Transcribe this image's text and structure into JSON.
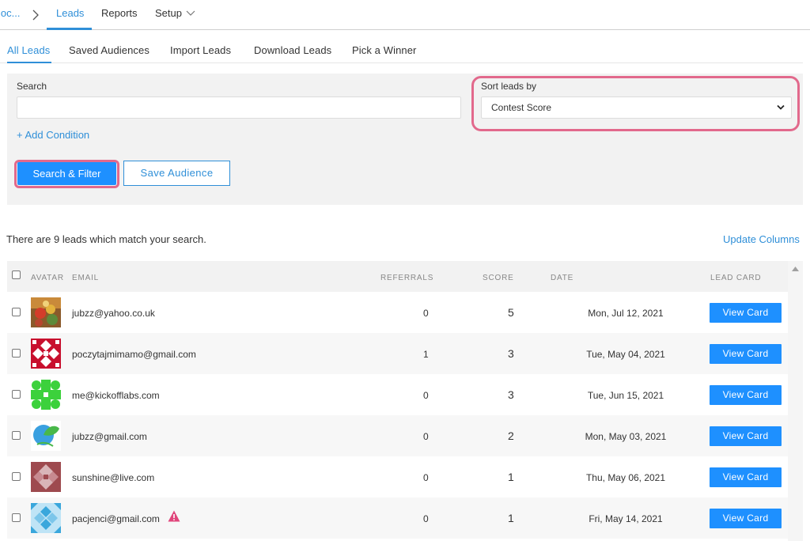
{
  "topnav": {
    "crumb": "loc...",
    "items": [
      "Leads",
      "Reports",
      "Setup"
    ]
  },
  "subtabs": [
    "All Leads",
    "Saved Audiences",
    "Import Leads",
    "Download Leads",
    "Pick a Winner"
  ],
  "filter": {
    "search_label": "Search",
    "search_value": "",
    "sort_label": "Sort leads by",
    "sort_value": "Contest Score",
    "add_condition": "+ Add Condition",
    "search_button": "Search & Filter",
    "save_button": "Save Audience"
  },
  "summary": {
    "match_text": "There are 9 leads which match your search.",
    "update_columns": "Update Columns"
  },
  "table": {
    "headers": [
      "AVATAR",
      "EMAIL",
      "REFERRALS",
      "SCORE",
      "DATE",
      "LEAD CARD"
    ],
    "rows": [
      {
        "email": "jubzz@yahoo.co.uk",
        "referrals": "0",
        "score": "5",
        "date": "Mon, Jul 12, 2021",
        "action": "View Card"
      },
      {
        "email": "poczytajmimamo@gmail.com",
        "referrals": "1",
        "score": "3",
        "date": "Tue, May 04, 2021",
        "action": "View Card"
      },
      {
        "email": "me@kickofflabs.com",
        "referrals": "0",
        "score": "3",
        "date": "Tue, Jun 15, 2021",
        "action": "View Card"
      },
      {
        "email": "jubzz@gmail.com",
        "referrals": "0",
        "score": "2",
        "date": "Mon, May 03, 2021",
        "action": "View Card"
      },
      {
        "email": "sunshine@live.com",
        "referrals": "0",
        "score": "1",
        "date": "Thu, May 06, 2021",
        "action": "View Card"
      },
      {
        "email": "pacjenci@gmail.com",
        "referrals": "0",
        "score": "1",
        "date": "Fri, May 14, 2021",
        "action": "View Card"
      }
    ]
  },
  "colors": {
    "accent": "#2f8fd8",
    "button": "#1e90ff",
    "highlight": "#e2698c",
    "warning": "#e0457b"
  }
}
